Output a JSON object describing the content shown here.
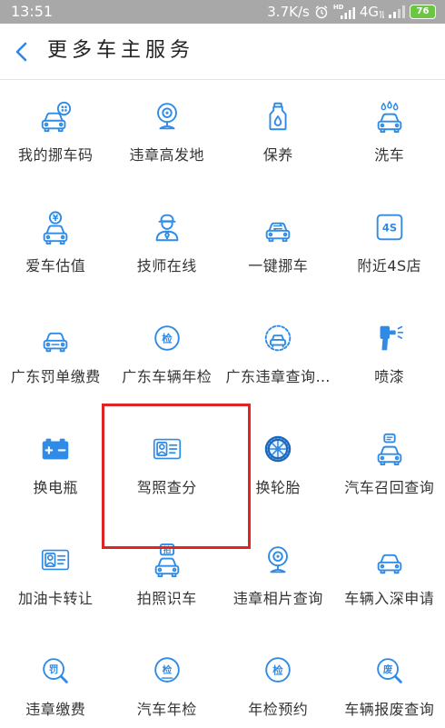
{
  "status_bar": {
    "time": "13:51",
    "net_speed": "3.7K/s",
    "hd_label": "HD",
    "network_type": "4G",
    "battery_level": "76",
    "icons": [
      "alarm-icon",
      "hd-signal-icon",
      "signal-icon",
      "battery-icon"
    ]
  },
  "header": {
    "back_icon": "chevron-left-icon",
    "title": "更多车主服务"
  },
  "services": [
    {
      "label": "我的挪车码",
      "icon": "car-code-icon"
    },
    {
      "label": "违章高发地",
      "icon": "camera-icon"
    },
    {
      "label": "保养",
      "icon": "oil-bottle-icon"
    },
    {
      "label": "洗车",
      "icon": "car-wash-icon"
    },
    {
      "label": "爱车估值",
      "icon": "car-value-icon",
      "glyph": "¥"
    },
    {
      "label": "技师在线",
      "icon": "mechanic-icon"
    },
    {
      "label": "一键挪车",
      "icon": "car-move-icon"
    },
    {
      "label": "附近4S店",
      "icon": "4s-store-icon",
      "glyph": "4S"
    },
    {
      "label": "广东罚单缴费",
      "icon": "car-front-icon"
    },
    {
      "label": "广东车辆年检",
      "icon": "inspection-icon",
      "glyph": "检"
    },
    {
      "label": "广东违章查询…",
      "icon": "violation-query-icon"
    },
    {
      "label": "喷漆",
      "icon": "spray-gun-icon"
    },
    {
      "label": "换电瓶",
      "icon": "battery-icon"
    },
    {
      "label": "驾照查分",
      "icon": "license-card-icon"
    },
    {
      "label": "换轮胎",
      "icon": "tire-icon"
    },
    {
      "label": "汽车召回查询",
      "icon": "car-recall-icon"
    },
    {
      "label": "加油卡转让",
      "icon": "fuel-card-icon"
    },
    {
      "label": "拍照识车",
      "icon": "photo-recognize-icon",
      "glyph": "拍"
    },
    {
      "label": "违章相片查询",
      "icon": "camera-icon"
    },
    {
      "label": "车辆入深申请",
      "icon": "car-front-icon"
    },
    {
      "label": "违章缴费",
      "icon": "fine-search-icon",
      "glyph": "罚"
    },
    {
      "label": "汽车年检",
      "icon": "car-inspection-icon",
      "glyph": "检"
    },
    {
      "label": "年检预约",
      "icon": "inspection-booking-icon",
      "glyph": "检"
    },
    {
      "label": "车辆报废查询",
      "icon": "scrap-search-icon",
      "glyph": "废"
    }
  ],
  "colors": {
    "accent": "#2f8be6",
    "status_bar": "#a8a8a8",
    "highlight": "#e02424",
    "battery": "#6cc644"
  }
}
